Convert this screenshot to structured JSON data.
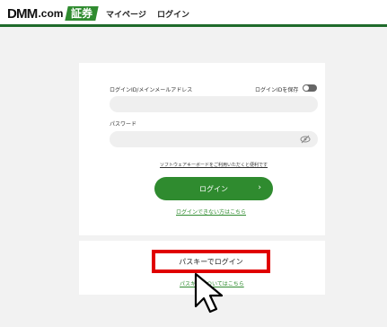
{
  "header": {
    "logo_main": "DMM",
    "logo_com": ".com",
    "logo_badge": "証券",
    "nav_mypage": "マイページ",
    "nav_login": "ログイン",
    "accent_color": "#1f6b2b"
  },
  "login_form": {
    "id_label": "ログインID/メインメールアドレス",
    "save_id_label": "ログインIDを保存",
    "id_value": "",
    "password_label": "パスワード",
    "password_value": "",
    "software_keyboard_link": "ソフトウェアキーボードをご利用いただくと便利です",
    "login_button": "ログイン",
    "cannot_login_link": "ログインできない方はこちら",
    "button_color": "#2f8b2f"
  },
  "passkey": {
    "button_label": "パスキーでログイン",
    "help_link": "パスキーについてはこちら",
    "highlight_color": "#e00000"
  },
  "icons": {
    "eye": "eye-slash-icon",
    "chevron": "chevron-right-icon",
    "cursor": "mouse-pointer-icon"
  }
}
